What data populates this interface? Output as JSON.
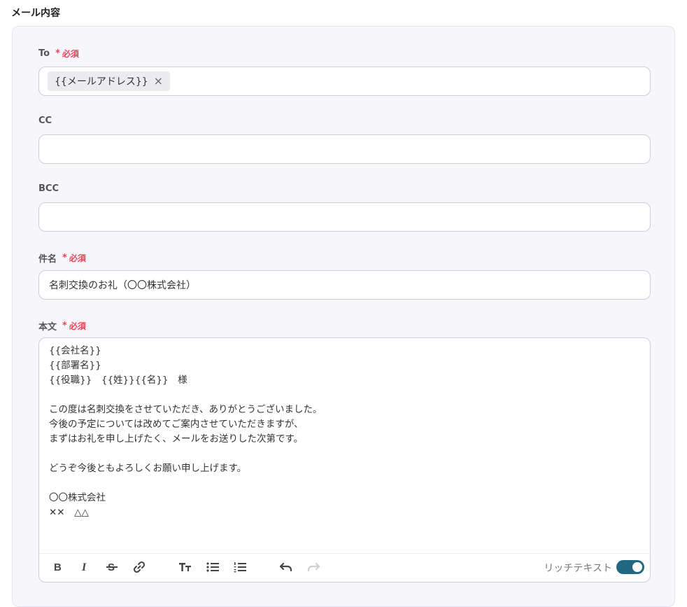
{
  "section_title": "メール内容",
  "required_label": "必須",
  "required_star": "*",
  "fields": {
    "to": {
      "label": "To",
      "chip": "{{メールアドレス}}",
      "chip_remove": "×"
    },
    "cc": {
      "label": "CC",
      "value": ""
    },
    "bcc": {
      "label": "BCC",
      "value": ""
    },
    "subject": {
      "label": "件名",
      "value": "名刺交換のお礼（〇〇株式会社）"
    },
    "body": {
      "label": "本文",
      "value": "{{会社名}}\n{{部署名}}\n{{役職}}　{{姓}}{{名}}　様\n\nこの度は名刺交換をさせていただき、ありがとうございました。\n今後の予定については改めてご案内させていただきますが、\nまずはお礼を申し上げたく、メールをお送りした次第です。\n\nどうぞ今後ともよろしくお願い申し上げます。\n\n〇〇株式会社\n✕✕　△△"
    }
  },
  "toolbar": {
    "icons": [
      "bold-icon",
      "italic-icon",
      "strikethrough-icon",
      "link-icon",
      "heading-icon",
      "bulleted-list-icon",
      "numbered-list-icon",
      "undo-icon",
      "redo-icon"
    ],
    "rich_text_label": "リッチテキスト",
    "rich_text_enabled": true,
    "accent_color": "#1f6a80",
    "required_color": "#e8445a"
  }
}
